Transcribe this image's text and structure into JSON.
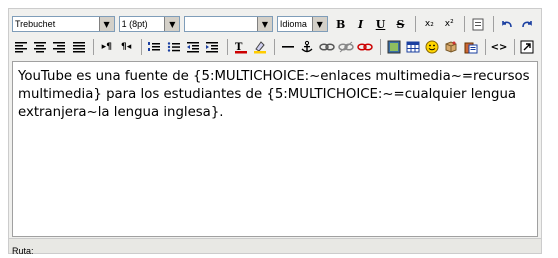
{
  "toolbar": {
    "font_family": "Trebuchet",
    "font_size": "1 (8pt)",
    "format": "",
    "language": "Idioma",
    "buttons": {
      "bold": "B",
      "italic": "I",
      "underline": "U",
      "strike": "S",
      "subscript": "x₂",
      "superscript": "x²",
      "ltr": "▸¶",
      "rtl": "¶◂",
      "html": "<>"
    }
  },
  "content": {
    "text": "YouTube es una fuente de {5:MULTICHOICE:~enlaces multimedia~=recursos multimedia} para los estudiantes de {5:MULTICHOICE:~=cualquier lengua extranjera~la lengua inglesa}."
  },
  "status": {
    "path_label": "Ruta:"
  }
}
